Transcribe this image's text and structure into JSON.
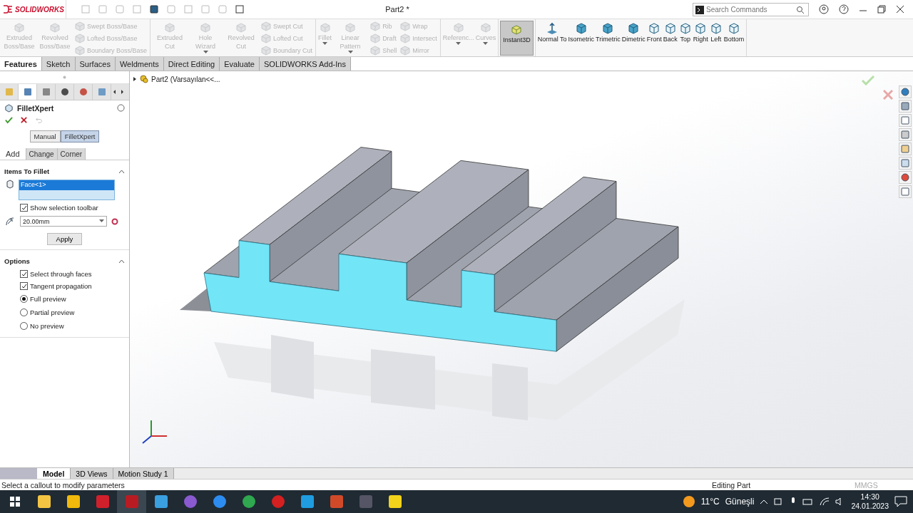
{
  "app": {
    "logo": "SOLIDWORKS",
    "title": "Part2 *"
  },
  "search": {
    "placeholder": "Search Commands"
  },
  "ribbon": [
    {
      "items": [
        {
          "label": "Extruded Boss/Base",
          "kind": "large",
          "disabled": true
        },
        {
          "label": "Revolved Boss/Base",
          "kind": "large",
          "disabled": true
        },
        {
          "label": "Swept Boss/Base",
          "kind": "small",
          "disabled": true
        },
        {
          "label": "Lofted Boss/Base",
          "kind": "small",
          "disabled": true
        },
        {
          "label": "Boundary Boss/Base",
          "kind": "small",
          "disabled": true
        }
      ]
    },
    {
      "items": [
        {
          "label": "Extruded Cut",
          "kind": "large",
          "disabled": true
        },
        {
          "label": "Hole Wizard",
          "kind": "large",
          "disabled": true,
          "dropdown": true
        },
        {
          "label": "Revolved Cut",
          "kind": "large",
          "disabled": true
        },
        {
          "label": "Swept Cut",
          "kind": "small",
          "disabled": true
        },
        {
          "label": "Lofted Cut",
          "kind": "small",
          "disabled": true
        },
        {
          "label": "Boundary Cut",
          "kind": "small",
          "disabled": true
        }
      ]
    },
    {
      "items": [
        {
          "label": "Fillet",
          "kind": "large",
          "disabled": true,
          "dropdown": true
        },
        {
          "label": "Linear Pattern",
          "kind": "large",
          "disabled": true,
          "dropdown": true
        },
        {
          "label": "Rib",
          "kind": "small",
          "disabled": true
        },
        {
          "label": "Draft",
          "kind": "small",
          "disabled": true
        },
        {
          "label": "Shell",
          "kind": "small",
          "disabled": true
        },
        {
          "label": "Wrap",
          "kind": "small",
          "disabled": true
        },
        {
          "label": "Intersect",
          "kind": "small",
          "disabled": true
        },
        {
          "label": "Mirror",
          "kind": "small",
          "disabled": true
        }
      ]
    },
    {
      "items": [
        {
          "label": "Referenc...",
          "kind": "large",
          "disabled": true,
          "dropdown": true
        },
        {
          "label": "Curves",
          "kind": "large",
          "disabled": true,
          "dropdown": true
        }
      ]
    },
    {
      "items": [
        {
          "label": "Instant3D",
          "kind": "large",
          "disabled": false,
          "selected": true
        }
      ]
    },
    {
      "items": [
        {
          "label": "Normal To",
          "kind": "view",
          "disabled": false
        },
        {
          "label": "Isometric",
          "kind": "view",
          "disabled": false
        },
        {
          "label": "Trimetric",
          "kind": "view",
          "disabled": false
        },
        {
          "label": "Dimetric",
          "kind": "view",
          "disabled": false
        },
        {
          "label": "Front",
          "kind": "view",
          "disabled": false
        },
        {
          "label": "Back",
          "kind": "view",
          "disabled": false
        },
        {
          "label": "Top",
          "kind": "view",
          "disabled": false
        },
        {
          "label": "Right",
          "kind": "view",
          "disabled": false
        },
        {
          "label": "Left",
          "kind": "view",
          "disabled": false
        },
        {
          "label": "Bottom",
          "kind": "view",
          "disabled": false
        }
      ]
    }
  ],
  "tabs": [
    {
      "label": "Features",
      "selected": true
    },
    {
      "label": "Sketch",
      "selected": false
    },
    {
      "label": "Surfaces",
      "selected": false
    },
    {
      "label": "Weldments",
      "selected": false
    },
    {
      "label": "Direct Editing",
      "selected": false
    },
    {
      "label": "Evaluate",
      "selected": false
    },
    {
      "label": "SOLIDWORKS Add-Ins",
      "selected": false
    }
  ],
  "panel_tabs": [
    {
      "selected": false
    },
    {
      "selected": true
    },
    {
      "selected": false
    },
    {
      "selected": false
    },
    {
      "selected": false
    },
    {
      "selected": false
    }
  ],
  "property_manager": {
    "title": "FilletXpert",
    "modes": [
      {
        "label": "Manual",
        "selected": false
      },
      {
        "label": "FilletXpert",
        "selected": true
      }
    ],
    "tabs": [
      {
        "label": "Add",
        "selected": true
      },
      {
        "label": "Change",
        "selected": false
      },
      {
        "label": "Corner",
        "selected": false
      }
    ],
    "sections": [
      {
        "kind": "items",
        "title": "Items To Fillet",
        "expanded": true,
        "selection": [
          {
            "label": "Face<1>",
            "selected": true
          }
        ],
        "checkbox": {
          "label": "Show selection toolbar",
          "checked": true
        },
        "radius": {
          "value": "20.00mm"
        },
        "apply": "Apply"
      },
      {
        "kind": "options",
        "title": "Options",
        "expanded": true,
        "checkboxes": [
          {
            "label": "Select through faces",
            "checked": true
          },
          {
            "label": "Tangent propagation",
            "checked": true
          }
        ],
        "radios": [
          {
            "label": "Full preview",
            "selected": true
          },
          {
            "label": "Partial preview",
            "selected": false
          },
          {
            "label": "No preview",
            "selected": false
          }
        ]
      }
    ]
  },
  "viewport": {
    "tree_root": {
      "label": "Part2  (Varsayılan<<...",
      "expanded": false
    }
  },
  "bottom_tabs": [
    {
      "label": "Model",
      "selected": true
    },
    {
      "label": "3D Views",
      "selected": false
    },
    {
      "label": "Motion Study 1",
      "selected": false
    }
  ],
  "status_bar": {
    "message": "Select a callout to modify parameters",
    "mode": "Editing Part",
    "units": "MMGS"
  },
  "taskbar": {
    "temperature": "11°C",
    "condition": "Güneşli",
    "time": "14:30",
    "date": "24.01.2023"
  }
}
